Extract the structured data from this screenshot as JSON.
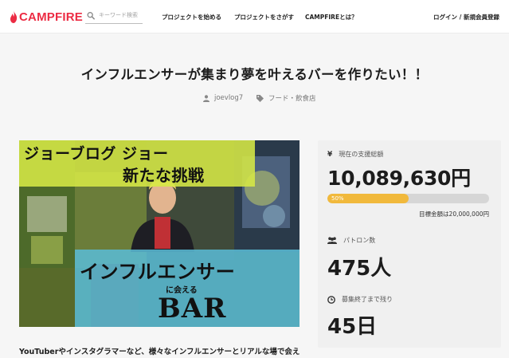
{
  "header": {
    "logo_text": "CAMPFIRE",
    "search_placeholder": "キーワード検索",
    "nav": {
      "start": "プロジェクトを始める",
      "find": "プロジェクトをさがす",
      "about": "CAMPFIREとは？",
      "login": "ログイン / 新規会員登録"
    }
  },
  "project": {
    "title": "インフルエンサーが集まり夢を叶えるバーを作りたい！！",
    "owner": "joevlog7",
    "category": "フード・飲食店",
    "image_text": {
      "line1": "ジョーブログ ジョー",
      "line2": "新たな挑戦",
      "line3": "インフルエンサー",
      "line4": "に会える",
      "line5": "BAR"
    },
    "description": "YouTuberやインスタグラマーなど、様々なインフルエンサーとリアルな場で会え"
  },
  "stats": {
    "total_label": "現在の支援総額",
    "total_value": "10,089,630円",
    "progress_percent": 50,
    "progress_label": "50%",
    "goal_text": "目標金額は20,000,000円",
    "backers_label": "パトロン数",
    "backers_value": "475人",
    "days_label": "募集終了まで残り",
    "days_value": "45日"
  },
  "colors": {
    "brand": "#ec2b43",
    "progress": "#f1b93c"
  }
}
